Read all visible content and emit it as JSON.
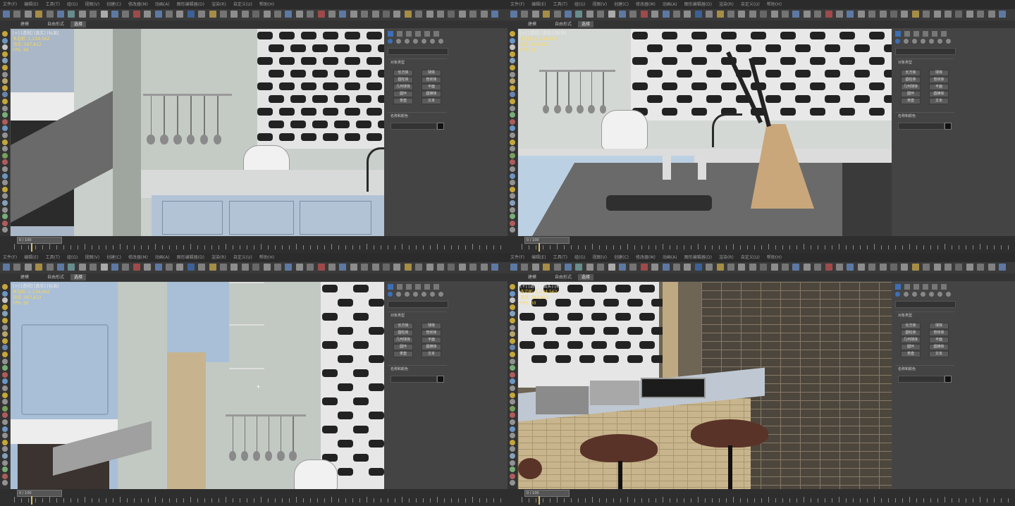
{
  "panes": [
    {
      "id": "top-left",
      "menu": [
        "文件(F)",
        "编辑(E)",
        "工具(T)",
        "组(G)",
        "视图(V)",
        "创建(C)",
        "修改器(M)",
        "动画(A)",
        "图形编辑器(D)",
        "渲染(R)",
        "自定义(U)",
        "帮助(H)"
      ],
      "tabs": [
        "建模",
        "自由形式",
        "选择"
      ],
      "viewport_label": "[+] [透视] [真实] [标准]",
      "stats": [
        "多边形: 1,234,562",
        "顶点: 567,812",
        "FPS: 30"
      ],
      "panel_buttons": [
        "长方体",
        "球体",
        "圆柱体",
        "管状体",
        "几何球体",
        "平面",
        "圆环",
        "圆锥体",
        "茶壶",
        "文本"
      ],
      "panel_sections": [
        "对象类型",
        "名称和颜色"
      ],
      "timeline_label": "0 / 100"
    },
    {
      "id": "top-right",
      "menu": [
        "文件(F)",
        "编辑(E)",
        "工具(T)",
        "组(G)",
        "视图(V)",
        "创建(C)",
        "修改器(M)",
        "动画(A)",
        "图形编辑器(D)",
        "渲染(R)",
        "自定义(U)",
        "帮助(H)"
      ],
      "tabs": [
        "建模",
        "自由形式",
        "选择"
      ],
      "viewport_label": "[+] [透视] [真实] [标准]",
      "stats": [
        "多边形: 1,234,562",
        "顶点: 567,812",
        "FPS: 30"
      ],
      "panel_buttons": [
        "长方体",
        "球体",
        "圆柱体",
        "管状体",
        "几何球体",
        "平面",
        "圆环",
        "圆锥体",
        "茶壶",
        "文本"
      ],
      "panel_sections": [
        "对象类型",
        "名称和颜色"
      ],
      "timeline_label": "0 / 100"
    },
    {
      "id": "bottom-left",
      "menu": [
        "文件(F)",
        "编辑(E)",
        "工具(T)",
        "组(G)",
        "视图(V)",
        "创建(C)",
        "修改器(M)",
        "动画(A)",
        "图形编辑器(D)",
        "渲染(R)",
        "自定义(U)",
        "帮助(H)"
      ],
      "tabs": [
        "建模",
        "自由形式",
        "选择"
      ],
      "viewport_label": "[+] [透视] [真实] [标准]",
      "stats": [
        "多边形: 1,234,562",
        "顶点: 567,812",
        "FPS: 30"
      ],
      "panel_buttons": [
        "长方体",
        "球体",
        "圆柱体",
        "管状体",
        "几何球体",
        "平面",
        "圆环",
        "圆锥体",
        "茶壶",
        "文本"
      ],
      "panel_sections": [
        "对象类型",
        "名称和颜色"
      ],
      "timeline_label": "0 / 100"
    },
    {
      "id": "bottom-right",
      "menu": [
        "文件(F)",
        "编辑(E)",
        "工具(T)",
        "组(G)",
        "视图(V)",
        "创建(C)",
        "修改器(M)",
        "动画(A)",
        "图形编辑器(D)",
        "渲染(R)",
        "自定义(U)",
        "帮助(H)"
      ],
      "tabs": [
        "建模",
        "自由形式",
        "选择"
      ],
      "viewport_label": "[+] [透视] [真实] [标准]",
      "stats": [
        "多边形: 1,234,562",
        "顶点: 567,812",
        "FPS: 30"
      ],
      "panel_buttons": [
        "长方体",
        "球体",
        "圆柱体",
        "管状体",
        "几何球体",
        "平面",
        "圆环",
        "圆锥体",
        "茶壶",
        "文本"
      ],
      "panel_sections": [
        "对象类型",
        "名称和颜色"
      ],
      "timeline_label": "0 / 100"
    }
  ],
  "colors": {
    "accent_blue": "#3d6fb5",
    "stats_yellow": "#ffd84a",
    "viewport_border": "#d6c26a"
  }
}
